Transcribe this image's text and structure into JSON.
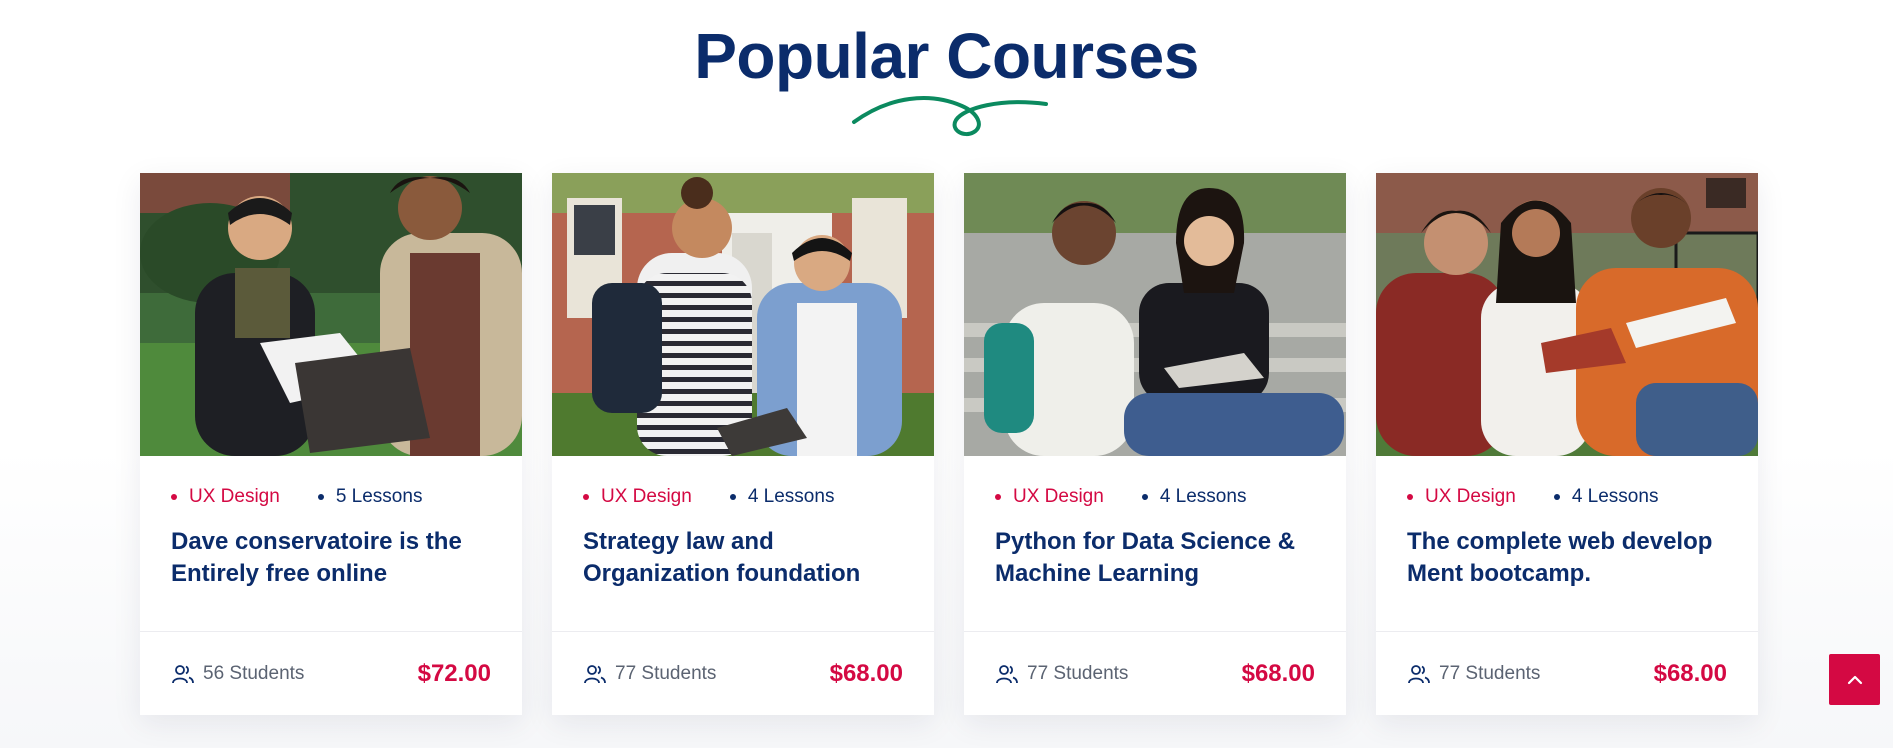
{
  "section": {
    "title": "Popular Courses",
    "accent_color": "#0b8a5f",
    "title_color": "#0b2c6b",
    "highlight_color": "#d40943"
  },
  "courses": [
    {
      "category": "UX Design",
      "lessons": "5 Lessons",
      "title_line1": "Dave conservatoire is the",
      "title_line2": "Entirely free online",
      "students": "56 Students",
      "price": "$72.00",
      "image": "students-looking-at-papers-photo"
    },
    {
      "category": "UX Design",
      "lessons": "4 Lessons",
      "title_line1": "Strategy law and",
      "title_line2": "Organization foundation",
      "students": "77 Students",
      "price": "$68.00",
      "image": "students-with-folder-photo"
    },
    {
      "category": "UX Design",
      "lessons": "4 Lessons",
      "title_line1": "Python for Data Science &",
      "title_line2": "Machine Learning",
      "students": "77 Students",
      "price": "$68.00",
      "image": "students-sitting-on-steps-photo"
    },
    {
      "category": "UX Design",
      "lessons": "4 Lessons",
      "title_line1": "The complete web develop",
      "title_line2": "Ment bootcamp.",
      "students": "77 Students",
      "price": "$68.00",
      "image": "students-studying-on-grass-photo"
    }
  ],
  "scroll_top": {
    "icon": "chevron-up-icon"
  }
}
